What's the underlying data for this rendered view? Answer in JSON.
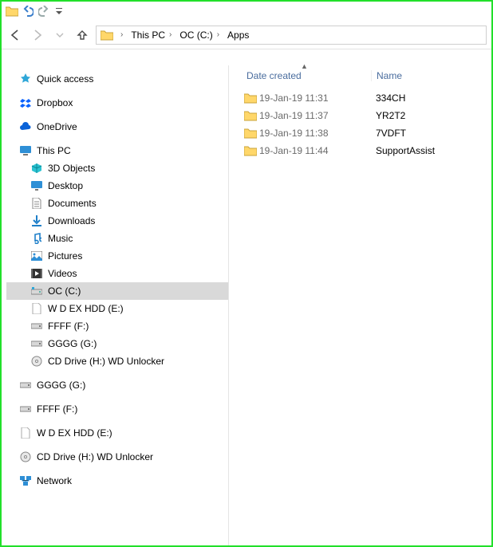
{
  "breadcrumb": [
    "This PC",
    "OC  (C:)",
    "Apps"
  ],
  "columns": {
    "date": "Date created",
    "name": "Name"
  },
  "files": [
    {
      "date": "19-Jan-19 11:31",
      "name": "334CH"
    },
    {
      "date": "19-Jan-19 11:37",
      "name": "YR2T2"
    },
    {
      "date": "19-Jan-19 11:38",
      "name": "7VDFT"
    },
    {
      "date": "19-Jan-19 11:44",
      "name": "SupportAssist"
    }
  ],
  "nav": {
    "quick_access": "Quick access",
    "dropbox": "Dropbox",
    "onedrive": "OneDrive",
    "this_pc": "This PC",
    "objects3d": "3D Objects",
    "desktop": "Desktop",
    "documents": "Documents",
    "downloads": "Downloads",
    "music": "Music",
    "pictures": "Pictures",
    "videos": "Videos",
    "oc_c": "OC  (C:)",
    "wd_ex_e": "W D EX HDD  (E:)",
    "ffff_f": "FFFF (F:)",
    "gggg_g": "GGGG (G:)",
    "cd_h": "CD Drive (H:) WD Unlocker",
    "gggg_g2": "GGGG (G:)",
    "ffff_f2": "FFFF (F:)",
    "wd_ex_e2": "W D EX HDD  (E:)",
    "cd_h2": "CD Drive (H:) WD Unlocker",
    "network": "Network"
  }
}
